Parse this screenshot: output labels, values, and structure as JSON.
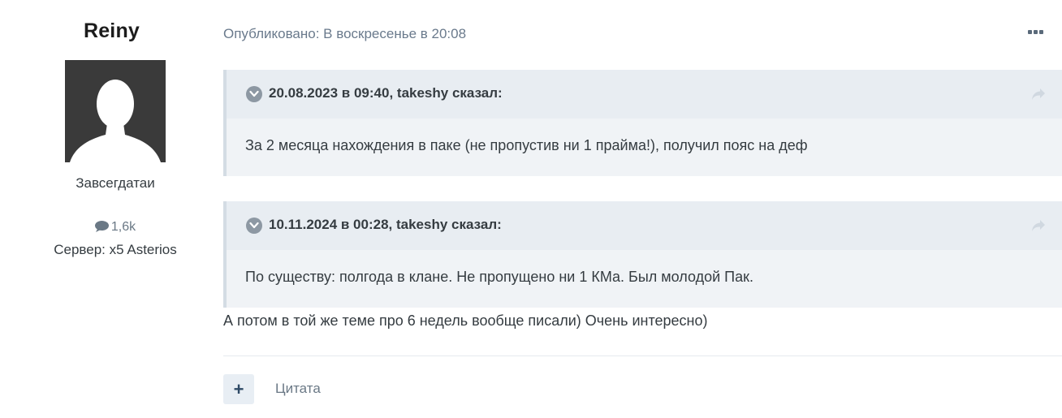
{
  "author": {
    "name": "Reiny",
    "rank": "Завсегдатаи",
    "posts_count": "1,6k",
    "server": "Сервер: x5 Asterios"
  },
  "post": {
    "published": "Опубликовано: В воскресенье в 20:08",
    "quotes": [
      {
        "citation": "20.08.2023 в 09:40, takeshy сказал:",
        "text": "За 2 месяца нахождения в паке (не пропустив ни 1 прайма!), получил пояс на деф"
      },
      {
        "citation": "10.11.2024 в 00:28, takeshy сказал:",
        "text": "По существу: полгода в клане. Не пропущено ни 1 КМа. Был молодой Пак."
      }
    ],
    "body": "А потом в той же теме про 6 недель вообще писали) Очень интересно)"
  },
  "actions": {
    "add_label": "+",
    "quote_label": "Цитата"
  },
  "icons": {
    "more": "more-dots-icon",
    "chevron": "chevron-down-icon",
    "share": "share-arrow-icon",
    "comment": "comment-bubble-icon",
    "avatar": "default-avatar-icon"
  }
}
